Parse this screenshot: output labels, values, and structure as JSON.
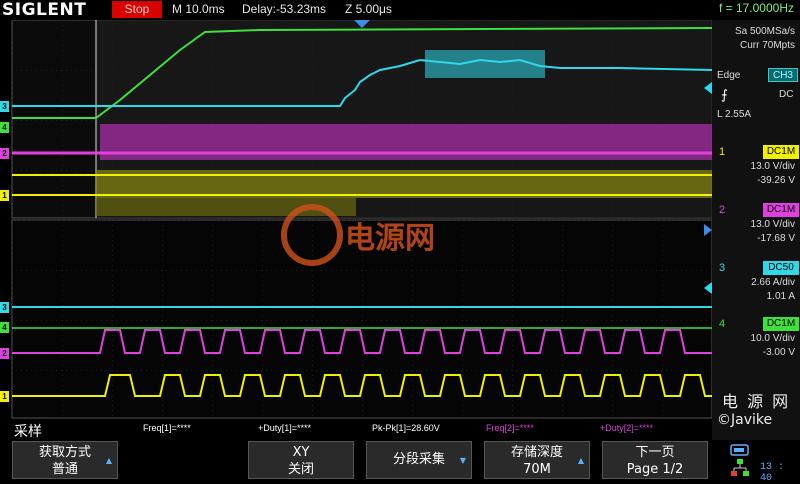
{
  "header": {
    "brand": "SIGLENT",
    "run_state": "Stop",
    "timebase": "M 10.0ms",
    "delay": "Delay:-53.23ms",
    "zoom": "Z 5.00μs",
    "frequency": "f = 17.0000Hz"
  },
  "acquisition": {
    "sample_rate": "Sa 500MSa/s",
    "memory": "Curr 70Mpts"
  },
  "trigger": {
    "type": "Edge",
    "source": "CH3",
    "coupling": "DC",
    "level": "L  2.55A"
  },
  "channels": [
    {
      "num": "1",
      "coupling": "DC1M",
      "vdiv": "13.0 V/div",
      "offset": "-39.26 V",
      "color": "#f0f000"
    },
    {
      "num": "2",
      "coupling": "DC1M",
      "vdiv": "13.0 V/div",
      "offset": "-17.68 V",
      "color": "#e040e0"
    },
    {
      "num": "3",
      "coupling": "DC50",
      "vdiv": "2.66 A/div",
      "offset": "1.01 A",
      "color": "#30d8e8"
    },
    {
      "num": "4",
      "coupling": "DC1M",
      "vdiv": "10.0 V/div",
      "offset": "-3.00 V",
      "color": "#40e040"
    }
  ],
  "marker_labels": [
    "3",
    "4",
    "2",
    "1"
  ],
  "measurements": [
    {
      "text": "Freq[1]=****",
      "color": "#ffffff"
    },
    {
      "text": "+Duty[1]=****",
      "color": "#ffffff"
    },
    {
      "text": "Pk-Pk[1]=28.60V",
      "color": "#ffffff"
    },
    {
      "text": "Freq[2]=****",
      "color": "#e040e0"
    },
    {
      "text": "+Duty[2]=****",
      "color": "#e040e0"
    }
  ],
  "watermark": {
    "center": "电源网",
    "right": "电 源 网",
    "credit": "©Javike"
  },
  "menu": {
    "mode": "采样",
    "acq_method_label": "获取方式",
    "acq_method_value": "普通",
    "xy_label": "XY",
    "xy_value": "关闭",
    "segmented": "分段采集",
    "memdepth_label": "存储深度",
    "memdepth_value": "70M",
    "next_label": "下一页",
    "next_value": "Page 1/2"
  },
  "clock": "13 : 40"
}
